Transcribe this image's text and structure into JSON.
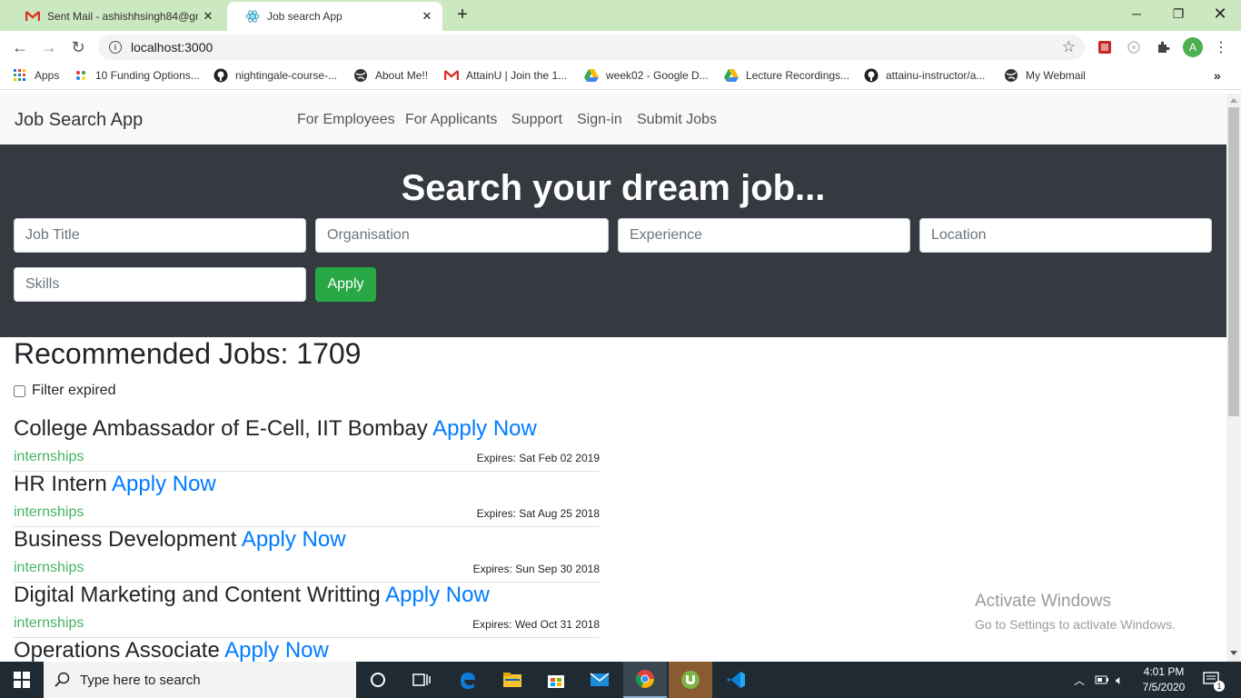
{
  "browser": {
    "tabs": [
      {
        "title": "Sent Mail - ashishhsingh84@gmail.com",
        "icon": "gmail-icon",
        "active": false
      },
      {
        "title": "Job search App",
        "icon": "react-icon",
        "active": true
      }
    ],
    "url": "localhost:3000",
    "profile_initial": "A",
    "bookmarks": [
      {
        "label": "Apps",
        "icon": "apps-grid-icon"
      },
      {
        "label": "10 Funding Options...",
        "icon": "colorful-dots-icon"
      },
      {
        "label": "nightingale-course-...",
        "icon": "github-icon"
      },
      {
        "label": "About Me!!",
        "icon": "globe-icon"
      },
      {
        "label": "AttainU | Join the 1...",
        "icon": "gmail-icon"
      },
      {
        "label": "week02 - Google D...",
        "icon": "google-drive-icon"
      },
      {
        "label": "Lecture Recordings...",
        "icon": "google-drive-icon"
      },
      {
        "label": "attainu-instructor/a...",
        "icon": "github-icon"
      },
      {
        "label": "My Webmail",
        "icon": "globe-icon"
      }
    ]
  },
  "app": {
    "brand": "Job Search App",
    "nav": [
      "For Employees",
      "For Applicants",
      "Support",
      "Sign-in",
      "Submit Jobs"
    ],
    "hero": {
      "title": "Search your dream job...",
      "placeholders": {
        "job_title": "Job Title",
        "organisation": "Organisation",
        "experience": "Experience",
        "location": "Location",
        "skills": "Skills"
      },
      "apply_label": "Apply"
    },
    "recommended_title": "Recommended Jobs: 1709",
    "filter_label": "Filter expired",
    "filter_checked": false,
    "apply_now_label": "Apply Now",
    "jobs": [
      {
        "title": "College Ambassador of E-Cell, IIT Bombay",
        "category": "internships",
        "expires": "Expires: Sat Feb 02 2019"
      },
      {
        "title": "HR Intern",
        "category": "internships",
        "expires": "Expires: Sat Aug 25 2018"
      },
      {
        "title": "Business Development",
        "category": "internships",
        "expires": "Expires: Sun Sep 30 2018"
      },
      {
        "title": "Digital Marketing and Content Writting",
        "category": "internships",
        "expires": "Expires: Wed Oct 31 2018"
      },
      {
        "title": "Operations Associate",
        "category": "",
        "expires": ""
      }
    ]
  },
  "watermark": {
    "line1": "Activate Windows",
    "line2": "Go to Settings to activate Windows."
  },
  "taskbar": {
    "search_placeholder": "Type here to search",
    "time": "4:01 PM",
    "date": "7/5/2020",
    "notification_count": "1"
  },
  "colors": {
    "tab_strip": "#cce8c0",
    "hero_bg": "#343a40",
    "apply_button": "#28a745",
    "link_blue": "#007bff",
    "taskbar": "#1f2a33"
  }
}
